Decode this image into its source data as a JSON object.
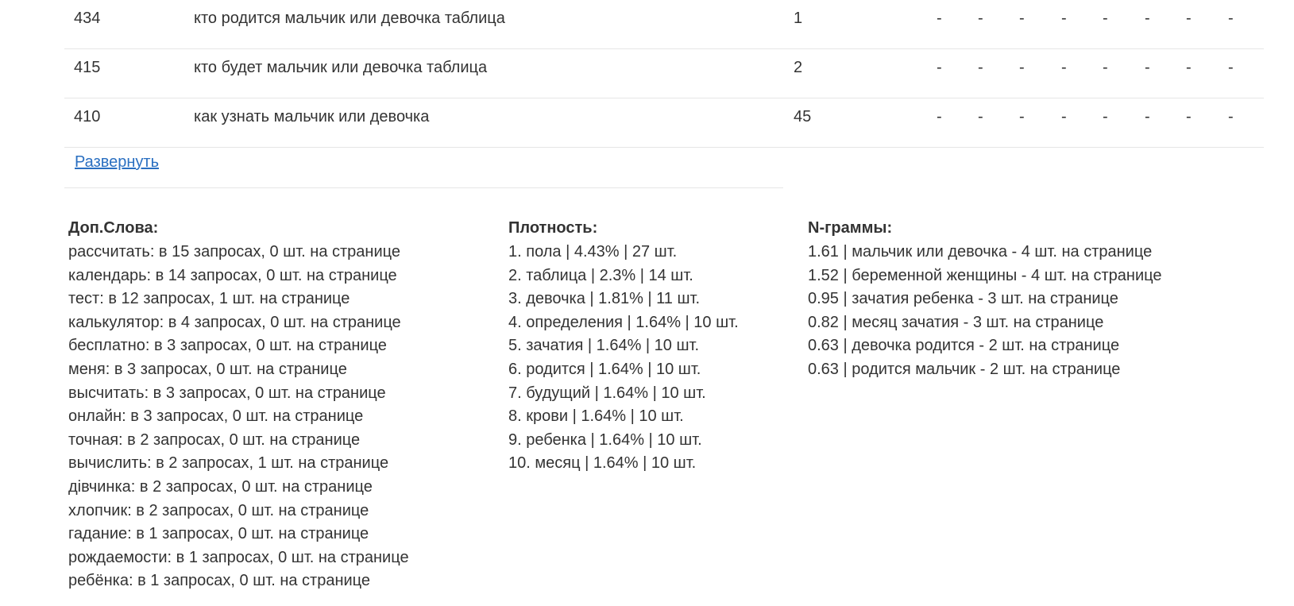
{
  "table": {
    "rows": [
      {
        "num": "434",
        "query": "кто родится мальчик или девочка таблица",
        "freq": "1",
        "dashes": [
          "-",
          "-",
          "-",
          "-",
          "-",
          "-",
          "-",
          "-"
        ]
      },
      {
        "num": "415",
        "query": "кто будет мальчик или девочка таблица",
        "freq": "2",
        "dashes": [
          "-",
          "-",
          "-",
          "-",
          "-",
          "-",
          "-",
          "-"
        ]
      },
      {
        "num": "410",
        "query": "как узнать мальчик или девочка",
        "freq": "45",
        "dashes": [
          "-",
          "-",
          "-",
          "-",
          "-",
          "-",
          "-",
          "-"
        ]
      }
    ],
    "expand_label": "Развернуть"
  },
  "extra_words": {
    "title": "Доп.Слова:",
    "items": [
      "рассчитать: в 15 запросах, 0 шт. на странице",
      "календарь: в 14 запросах, 0 шт. на странице",
      "тест: в 12 запросах, 1 шт. на странице",
      "калькулятор: в 4 запросах, 0 шт. на странице",
      "бесплатно: в 3 запросах, 0 шт. на странице",
      "меня: в 3 запросах, 0 шт. на странице",
      "высчитать: в 3 запросах, 0 шт. на странице",
      "онлайн: в 3 запросах, 0 шт. на странице",
      "точная: в 2 запросах, 0 шт. на странице",
      "вычислить: в 2 запросах, 1 шт. на странице",
      "дівчинка: в 2 запросах, 0 шт. на странице",
      "хлопчик: в 2 запросах, 0 шт. на странице",
      "гадание: в 1 запросах, 0 шт. на странице",
      "рождаемости: в 1 запросах, 0 шт. на странице",
      "ребёнка: в 1 запросах, 0 шт. на странице"
    ]
  },
  "density": {
    "title": "Плотность:",
    "items": [
      "1. пола | 4.43% | 27 шт.",
      "2. таблица | 2.3% | 14 шт.",
      "3. девочка | 1.81% | 11 шт.",
      "4. определения | 1.64% | 10 шт.",
      "5. зачатия | 1.64% | 10 шт.",
      "6. родится | 1.64% | 10 шт.",
      "7. будущий | 1.64% | 10 шт.",
      "8. крови | 1.64% | 10 шт.",
      "9. ребенка | 1.64% | 10 шт.",
      "10. месяц | 1.64% | 10 шт."
    ]
  },
  "ngrams": {
    "title": "N-граммы:",
    "items": [
      "1.61 | мальчик или девочка - 4 шт. на странице",
      "1.52 | беременной женщины - 4 шт. на странице",
      "0.95 | зачатия ребенка - 3 шт. на странице",
      "0.82 | месяц зачатия - 3 шт. на странице",
      "0.63 | девочка родится - 2 шт. на странице",
      "0.63 | родится мальчик - 2 шт. на странице"
    ]
  }
}
